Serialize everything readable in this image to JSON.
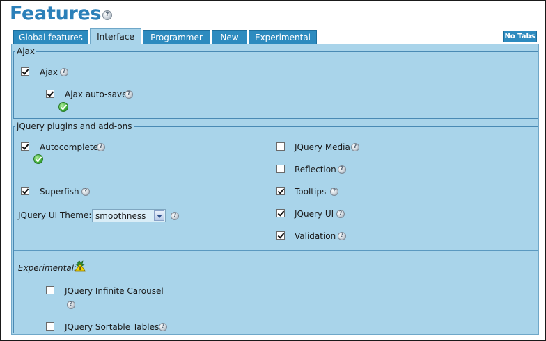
{
  "page": {
    "title": "Features"
  },
  "tabs": [
    {
      "label": "Global features",
      "active": false
    },
    {
      "label": "Interface",
      "active": true
    },
    {
      "label": "Programmer",
      "active": false
    },
    {
      "label": "New",
      "active": false
    },
    {
      "label": "Experimental",
      "active": false
    }
  ],
  "no_tabs_label": "No Tabs",
  "ajax": {
    "legend": "Ajax",
    "items": [
      {
        "label": "Ajax",
        "checked": true
      },
      {
        "label": "Ajax auto-save",
        "checked": true,
        "status": "ok-icon"
      }
    ]
  },
  "jquery": {
    "legend": "jQuery plugins and add-ons",
    "left": [
      {
        "label": "Autocomplete",
        "checked": true,
        "status": "ok-icon"
      },
      {
        "label": "Superfish",
        "checked": true
      }
    ],
    "theme": {
      "label": "JQuery UI Theme:",
      "value": "smoothness"
    },
    "right": [
      {
        "label": "JQuery Media",
        "checked": false
      },
      {
        "label": "Reflection",
        "checked": false
      },
      {
        "label": "Tooltips",
        "checked": true
      },
      {
        "label": "JQuery UI",
        "checked": true
      },
      {
        "label": "Validation",
        "checked": true
      }
    ],
    "experimental": {
      "label": "Experimental:",
      "icon": "experimental-warning-icon",
      "items": [
        {
          "label": "JQuery Infinite Carousel",
          "checked": false
        },
        {
          "label": "JQuery Sortable Tables",
          "checked": false
        }
      ]
    }
  },
  "colors": {
    "title": "#2b80b9",
    "tab": "#2d8bbf",
    "panel": "#a9d4ea",
    "border": "#4a8ab4"
  }
}
